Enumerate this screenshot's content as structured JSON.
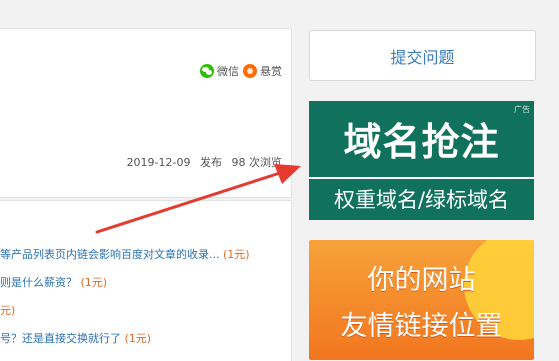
{
  "share": {
    "wechat": "微信",
    "reward": "悬赏"
  },
  "meta": {
    "date": "2019-12-09",
    "published": "发布",
    "views": "98 次浏览"
  },
  "related": [
    {
      "title": "等产品列表页内链会影响百度对文章的收录...",
      "price": "(1元)"
    },
    {
      "title": "则是什么薪资？",
      "price": "(1元)"
    },
    {
      "title": "",
      "price": "元)"
    },
    {
      "title": "号？还是直接交换就行了",
      "price": "(1元)"
    }
  ],
  "sidebar": {
    "ask_button": "提交问题",
    "ad1": {
      "tag": "广告",
      "headline": "域名抢注",
      "subline": "权重域名/绿标域名"
    },
    "ad2": {
      "line1": "你的网站",
      "line2": "友情链接位置"
    }
  }
}
